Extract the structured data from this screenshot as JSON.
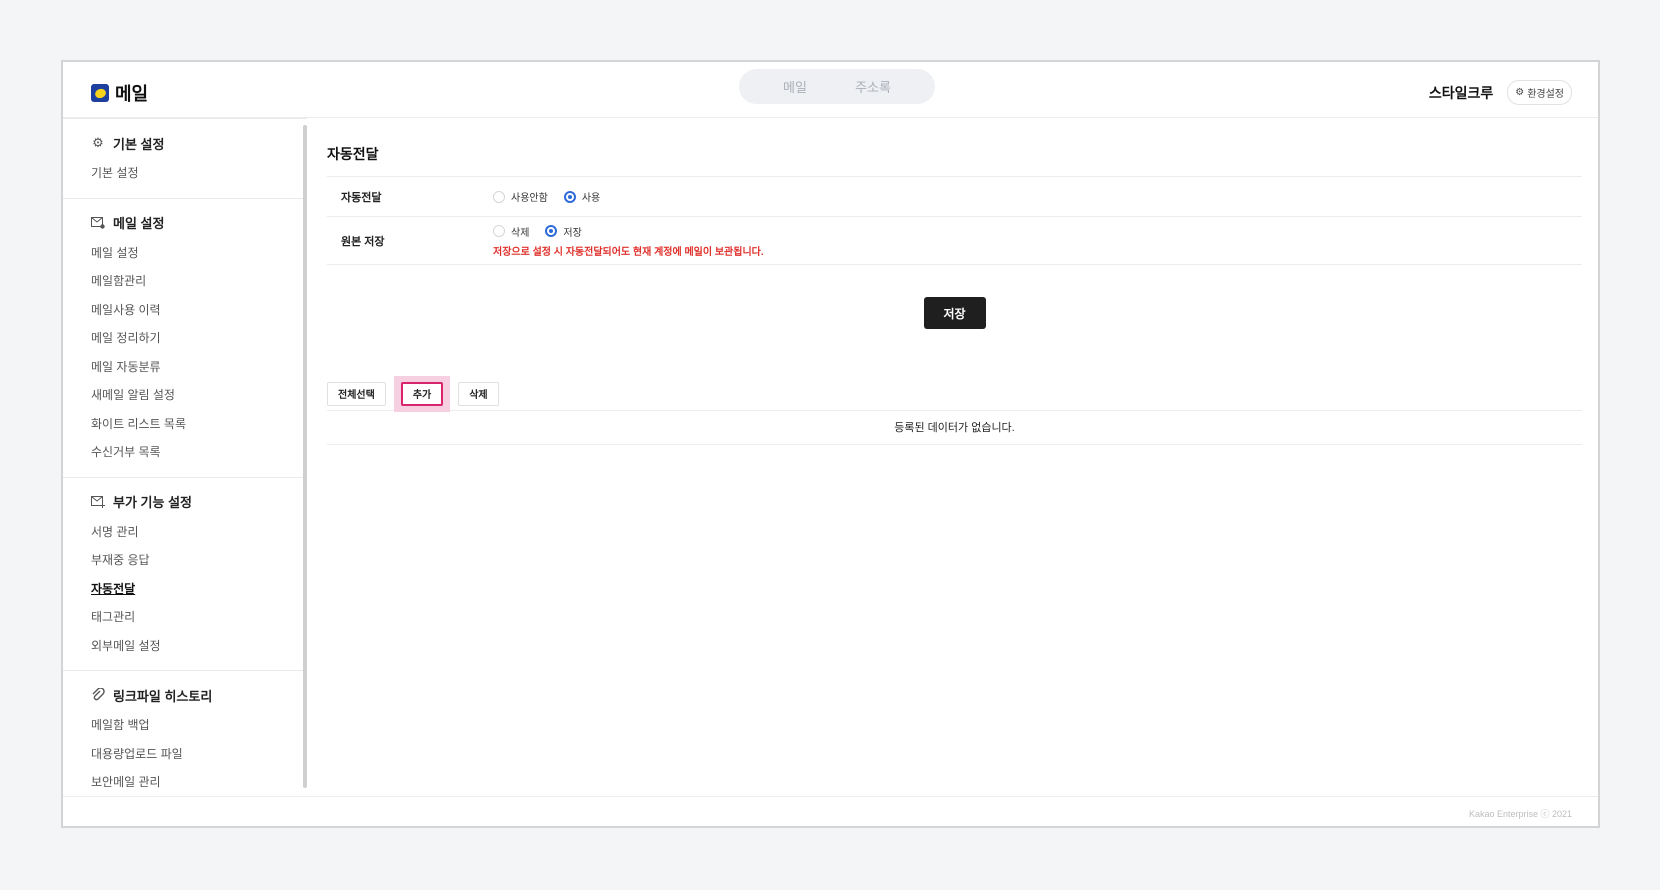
{
  "app": {
    "title": "메일"
  },
  "top_tabs": [
    {
      "label": "메일"
    },
    {
      "label": "주소록"
    }
  ],
  "user": {
    "name": "스타일크루",
    "settings_label": "환경설정"
  },
  "sidebar": {
    "sections": [
      {
        "title": "기본 설정",
        "icon": "gear-icon",
        "items": [
          {
            "label": "기본 설정"
          }
        ]
      },
      {
        "title": "메일 설정",
        "icon": "mail-settings-icon",
        "items": [
          {
            "label": "메일 설정"
          },
          {
            "label": "메일함관리"
          },
          {
            "label": "메일사용 이력"
          },
          {
            "label": "메일 정리하기"
          },
          {
            "label": "메일 자동분류"
          },
          {
            "label": "새메일 알림 설정"
          },
          {
            "label": "화이트 리스트 목록"
          },
          {
            "label": "수신거부 목록"
          }
        ]
      },
      {
        "title": "부가 기능 설정",
        "icon": "mail-plus-icon",
        "items": [
          {
            "label": "서명 관리"
          },
          {
            "label": "부재중 응답"
          },
          {
            "label": "자동전달",
            "active": true
          },
          {
            "label": "태그관리"
          },
          {
            "label": "외부메일 설정"
          }
        ]
      },
      {
        "title": "링크파일 히스토리",
        "icon": "paperclip-icon",
        "items": [
          {
            "label": "메일함 백업"
          },
          {
            "label": "대용량업로드 파일"
          },
          {
            "label": "보안메일 관리"
          }
        ]
      }
    ]
  },
  "main": {
    "title": "자동전달",
    "forward": {
      "label": "자동전달",
      "options": [
        {
          "label": "사용안함",
          "checked": false
        },
        {
          "label": "사용",
          "checked": true
        }
      ]
    },
    "keep_original": {
      "label": "원본 저장",
      "options": [
        {
          "label": "삭제",
          "checked": false
        },
        {
          "label": "저장",
          "checked": true
        }
      ],
      "warning": "저장으로 설정 시 자동전달되어도 현재 계정에 메일이 보관됩니다."
    },
    "save_label": "저장",
    "list_tools": {
      "select_all": "전체선택",
      "add": "추가",
      "delete": "삭제"
    },
    "empty_message": "등록된 데이터가 없습니다."
  },
  "footer": {
    "copyright": "Kakao Enterprise ⓒ 2021"
  },
  "colors": {
    "accent": "#2e6bd8",
    "warning": "#e0322c",
    "highlight": "#d9246e",
    "dark_button": "#1f1f1f"
  }
}
